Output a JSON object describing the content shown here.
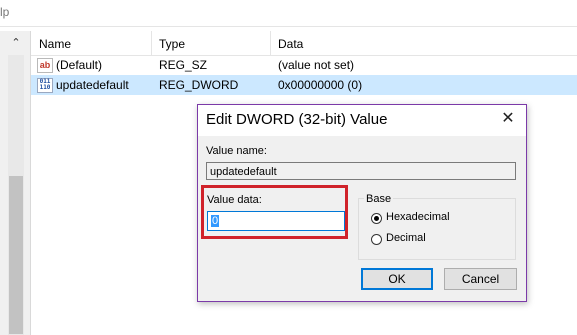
{
  "menu": {
    "fragment": "lp"
  },
  "list": {
    "columns": [
      "Name",
      "Type",
      "Data"
    ],
    "rows": [
      {
        "name": "(Default)",
        "type": "REG_SZ",
        "data": "(value not set)",
        "icon": "string-value-icon"
      },
      {
        "name": "updatedefault",
        "type": "REG_DWORD",
        "data": "0x00000000 (0)",
        "icon": "binary-value-icon"
      }
    ]
  },
  "dialog": {
    "title": "Edit DWORD (32-bit) Value",
    "close_glyph": "✕",
    "value_name_label": "Value name:",
    "value_name": "updatedefault",
    "value_data_label": "Value data:",
    "value_data": "0",
    "base_label": "Base",
    "base_options": [
      "Hexadecimal",
      "Decimal"
    ],
    "base_selected": "Hexadecimal",
    "ok_label": "OK",
    "cancel_label": "Cancel"
  },
  "colors": {
    "selection": "#cce8ff",
    "highlight_box": "#d0222a",
    "accent": "#0078d7",
    "dialog_border": "#7b3aa8"
  },
  "icons": {
    "ab": "ab",
    "bin": "011\n110"
  }
}
